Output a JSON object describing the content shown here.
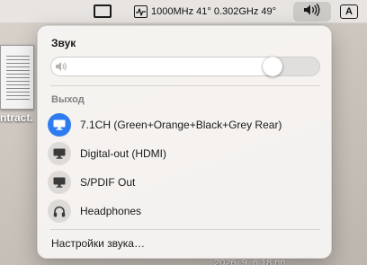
{
  "desktop": {
    "file_label": "ntract.",
    "bottom_text": "2026. 9.  6 18 пп"
  },
  "menubar": {
    "display_icon": "display-icon",
    "stats_icon": "activity-pulse-icon",
    "stats_text": "1000MHz 41° 0.302GHz 49°",
    "volume_icon": "speaker-wave-icon",
    "input_indicator": "A"
  },
  "sound_menu": {
    "title": "Звук",
    "volume_fraction": 0.85,
    "output_heading": "Выход",
    "devices": [
      {
        "label": "7.1CH (Green+Orange+Black+Grey Rear)",
        "icon": "display-icon",
        "selected": true
      },
      {
        "label": "Digital-out (HDMI)",
        "icon": "display-icon",
        "selected": false
      },
      {
        "label": "S/PDIF Out",
        "icon": "display-icon",
        "selected": false
      },
      {
        "label": "Headphones",
        "icon": "headphones-icon",
        "selected": false
      }
    ],
    "settings_link": "Настройки звука…"
  },
  "colors": {
    "accent": "#2f7bf0",
    "icon_bg": "#dddad7"
  }
}
